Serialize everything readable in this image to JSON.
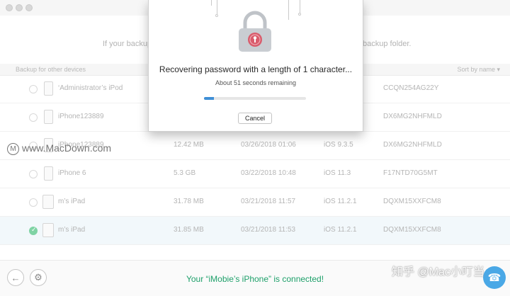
{
  "background_hints": {
    "left": "If your backup i",
    "right": "backup folder."
  },
  "list_header": {
    "left_label": "Backup for other devices",
    "sort_label": "Sort by name ▾"
  },
  "rows": [
    {
      "name": "‘Administrator’s iPod",
      "size": "",
      "date": "",
      "ios": "",
      "serial": "CCQN254AG22Y",
      "device": "ipod",
      "selected": false
    },
    {
      "name": "iPhone123889",
      "size": "",
      "date": "",
      "ios": "",
      "serial": "DX6MG2NHFMLD",
      "device": "iphone",
      "selected": false
    },
    {
      "name": "iPhone123889",
      "size": "12.42 MB",
      "date": "03/26/2018 01:06",
      "ios": "iOS 9.3.5",
      "serial": "DX6MG2NHFMLD",
      "device": "iphone",
      "selected": false
    },
    {
      "name": "iPhone 6",
      "size": "5.3 GB",
      "date": "03/22/2018 10:48",
      "ios": "iOS 11.3",
      "serial": "F17NTD70G5MT",
      "device": "iphone",
      "selected": false
    },
    {
      "name": "m’s iPad",
      "size": "31.78 MB",
      "date": "03/21/2018 11:57",
      "ios": "iOS 11.2.1",
      "serial": "DQXM15XXFCM8",
      "device": "ipad",
      "selected": false
    },
    {
      "name": "m’s iPad",
      "size": "31.85 MB",
      "date": "03/21/2018 11:53",
      "ios": "iOS 11.2.1",
      "serial": "DQXM15XXFCM8",
      "device": "ipad",
      "selected": true
    }
  ],
  "watermark": {
    "left": "www.MacDown.com",
    "left_mark": "M",
    "right": "知乎 @Mac小叮当"
  },
  "footer": {
    "status": "Your “iMobie’s iPhone” is connected!",
    "back_icon": "←",
    "settings_icon": "⚙",
    "help_icon": "☎"
  },
  "modal": {
    "title": "Recovering password with a length of 1 character...",
    "subtitle": "About 51 seconds remaining",
    "progress": 0.1,
    "cancel_label": "Cancel"
  },
  "colors": {
    "accent_blue": "#3f8fd6",
    "status_green": "#1ea06a",
    "lock_red": "#d95c6c"
  }
}
